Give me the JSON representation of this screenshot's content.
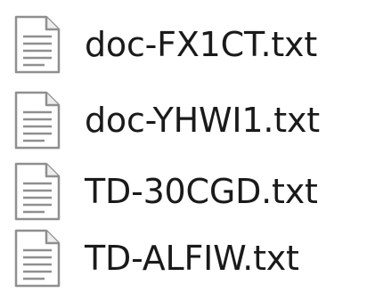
{
  "files": [
    {
      "name": "doc-FX1CT.txt",
      "icon": "text-file-icon"
    },
    {
      "name": "doc-YHWI1.txt",
      "icon": "text-file-icon"
    },
    {
      "name": "TD-30CGD.txt",
      "icon": "text-file-icon"
    },
    {
      "name": "TD-ALFIW.txt",
      "icon": "text-file-icon"
    }
  ]
}
